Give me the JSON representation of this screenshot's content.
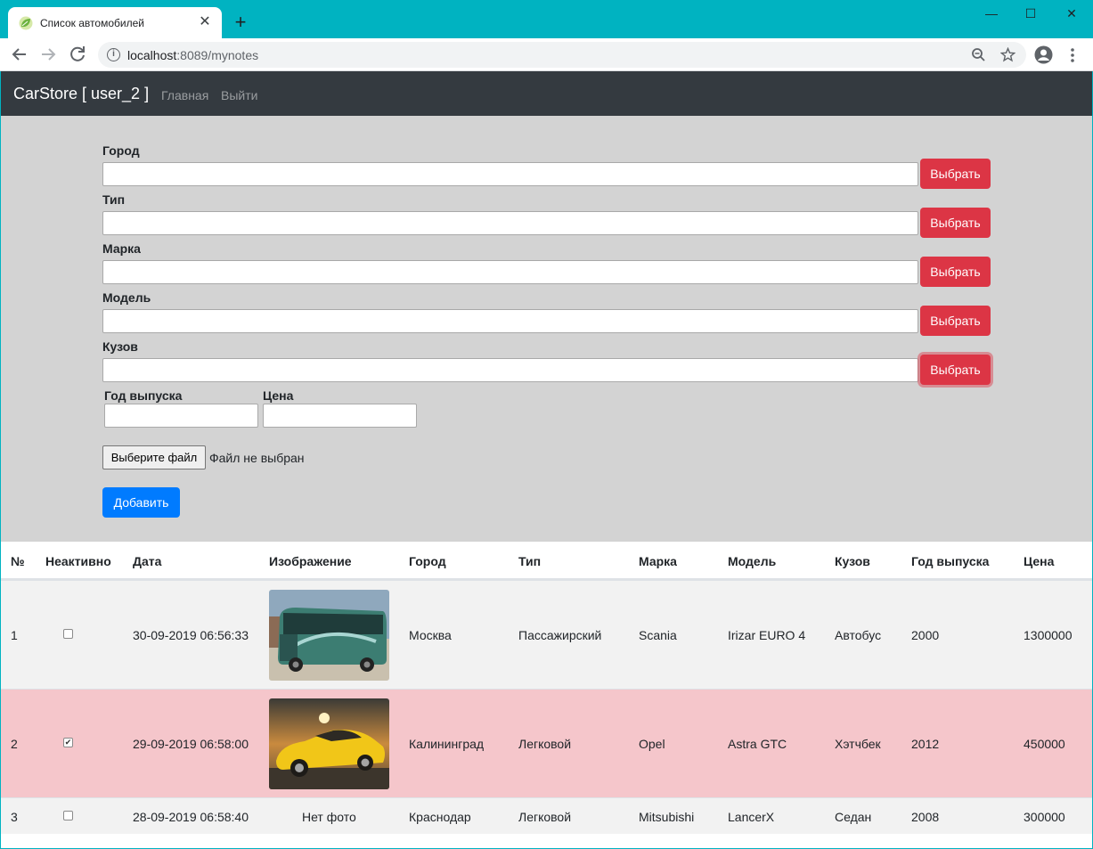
{
  "browser": {
    "tab_title": "Список автомобилей",
    "tab_close": "✕",
    "new_tab": "+",
    "url_host": "localhost",
    "url_rest": ":8089/mynotes",
    "controls": {
      "minimize": "—",
      "maximize": "☐",
      "close": "✕"
    }
  },
  "navbar": {
    "brand": "CarStore [ user_2 ]",
    "links": [
      "Главная",
      "Выйти"
    ]
  },
  "form": {
    "fields": [
      {
        "label": "Город",
        "value": "",
        "button": "Выбрать"
      },
      {
        "label": "Тип",
        "value": "",
        "button": "Выбрать"
      },
      {
        "label": "Марка",
        "value": "",
        "button": "Выбрать"
      },
      {
        "label": "Модель",
        "value": "",
        "button": "Выбрать"
      },
      {
        "label": "Кузов",
        "value": "",
        "button": "Выбрать"
      }
    ],
    "year_label": "Год выпуска",
    "price_label": "Цена",
    "file_button": "Выберите файл",
    "file_status": "Файл не выбран",
    "add_button": "Добавить"
  },
  "table": {
    "headers": [
      "№",
      "Неактивно",
      "Дата",
      "Изображение",
      "Город",
      "Тип",
      "Марка",
      "Модель",
      "Кузов",
      "Год выпуска",
      "Цена"
    ],
    "rows": [
      {
        "num": "1",
        "inactive": false,
        "date": "30-09-2019 06:56:33",
        "image": "bus-photo",
        "city": "Москва",
        "type": "Пассажирский",
        "brand": "Scania",
        "model": "Irizar EURO 4",
        "body": "Автобус",
        "year": "2000",
        "price": "1300000"
      },
      {
        "num": "2",
        "inactive": true,
        "date": "29-09-2019 06:58:00",
        "image": "yellow-car-photo",
        "city": "Калининград",
        "type": "Легковой",
        "brand": "Opel",
        "model": "Astra GTC",
        "body": "Хэтчбек",
        "year": "2012",
        "price": "450000"
      },
      {
        "num": "3",
        "inactive": false,
        "date": "28-09-2019 06:58:40",
        "image": "Нет фото",
        "city": "Краснодар",
        "type": "Легковой",
        "brand": "Mitsubishi",
        "model": "LancerX",
        "body": "Седан",
        "year": "2008",
        "price": "300000"
      }
    ]
  },
  "colors": {
    "titlebar": "#00b3c1",
    "navbar": "#343a40",
    "form_bg": "#d3d3d3",
    "danger": "#dc3545",
    "primary": "#007bff",
    "row_striped": "#f2f2f2",
    "row_inactive": "#f5c6cb"
  }
}
